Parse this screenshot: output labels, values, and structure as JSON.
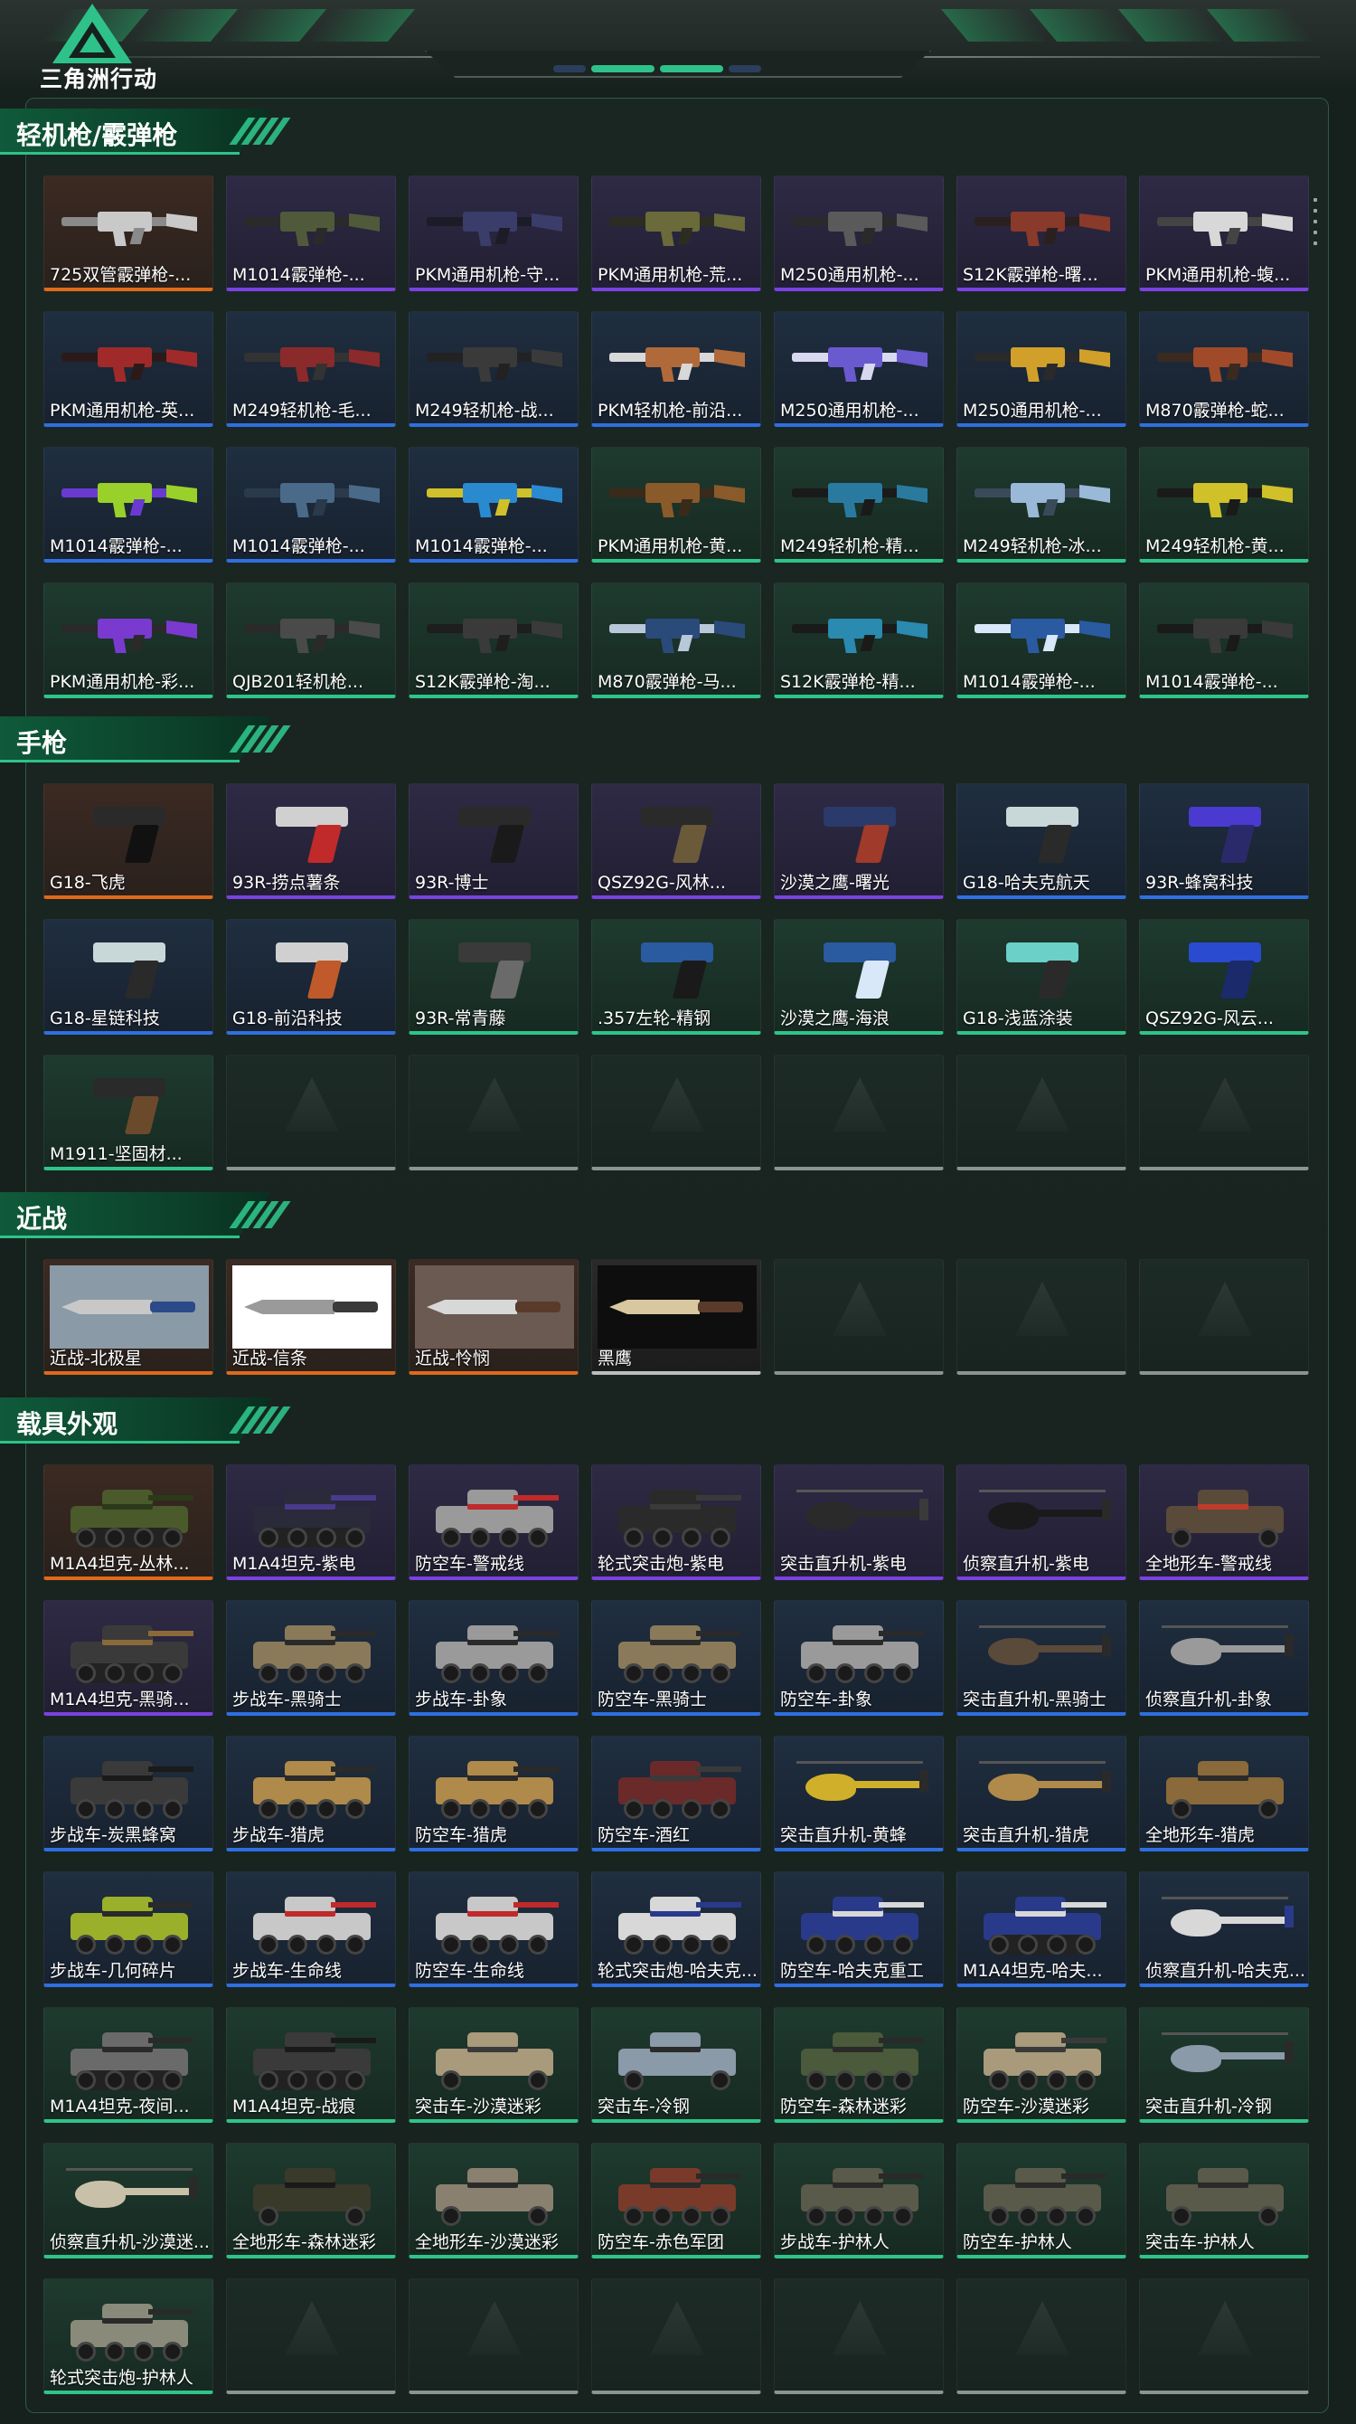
{
  "app": {
    "title": "三角洲行动"
  },
  "colors": {
    "accent": "#2ec28a",
    "rarity_orange": "#e06a1a",
    "rarity_purple": "#7a42e0",
    "rarity_blue": "#2f6fe0",
    "rarity_green": "#2fc48a",
    "rarity_white": "#bdbdbd",
    "empty_slot": "#8c948f"
  },
  "sections": [
    {
      "title": "轻机枪/霰弹枪",
      "kind": "gun",
      "items": [
        {
          "label": "725双管霰弹枪-...",
          "rarity": "orange",
          "tone": "#c9c9c9",
          "accent": "#8a8a8a"
        },
        {
          "label": "M1014霰弹枪-...",
          "rarity": "purple",
          "tone": "#505a3a",
          "accent": "#2a2a2a"
        },
        {
          "label": "PKM通用机枪-守...",
          "rarity": "purple",
          "tone": "#3a3d6a",
          "accent": "#1c1c28"
        },
        {
          "label": "PKM通用机枪-荒...",
          "rarity": "purple",
          "tone": "#6a6a3a",
          "accent": "#2c2c20"
        },
        {
          "label": "M250通用机枪-...",
          "rarity": "purple",
          "tone": "#5a5a5a",
          "accent": "#2a2a2a"
        },
        {
          "label": "S12K霰弹枪-曙...",
          "rarity": "purple",
          "tone": "#8a3a2a",
          "accent": "#2a2020"
        },
        {
          "label": "PKM通用机枪-蝮...",
          "rarity": "purple",
          "tone": "#d8d8d8",
          "accent": "#444444"
        },
        {
          "label": "PKM通用机枪-英...",
          "rarity": "blue",
          "tone": "#a02a2a",
          "accent": "#2a1a1a"
        },
        {
          "label": "M249轻机枪-毛...",
          "rarity": "blue",
          "tone": "#8a2a2a",
          "accent": "#333333"
        },
        {
          "label": "M249轻机枪-战...",
          "rarity": "blue",
          "tone": "#3a3a3a",
          "accent": "#222222"
        },
        {
          "label": "PKM轻机枪-前沿...",
          "rarity": "blue",
          "tone": "#b06a3a",
          "accent": "#d8d8d8"
        },
        {
          "label": "M250通用机枪-...",
          "rarity": "blue",
          "tone": "#6a5ad0",
          "accent": "#d8d8f0"
        },
        {
          "label": "M250通用机枪-...",
          "rarity": "blue",
          "tone": "#d0a02a",
          "accent": "#2a2a2a"
        },
        {
          "label": "M870霰弹枪-蛇...",
          "rarity": "blue",
          "tone": "#a04a2a",
          "accent": "#3a2a20"
        },
        {
          "label": "M1014霰弹枪-...",
          "rarity": "blue",
          "tone": "#9ad02a",
          "accent": "#6a3ad0"
        },
        {
          "label": "M1014霰弹枪-...",
          "rarity": "blue",
          "tone": "#4a6a8a",
          "accent": "#2a3a4a"
        },
        {
          "label": "M1014霰弹枪-...",
          "rarity": "blue",
          "tone": "#2a8ad0",
          "accent": "#d0c02a"
        },
        {
          "label": "PKM通用机枪-黄...",
          "rarity": "green",
          "tone": "#8a5a2a",
          "accent": "#3a2a1a"
        },
        {
          "label": "M249轻机枪-精...",
          "rarity": "green",
          "tone": "#2a7aa0",
          "accent": "#1a1a1a"
        },
        {
          "label": "M249轻机枪-冰...",
          "rarity": "green",
          "tone": "#9ab8d8",
          "accent": "#3a4a5a"
        },
        {
          "label": "M249轻机枪-黄...",
          "rarity": "green",
          "tone": "#d0c02a",
          "accent": "#1a1a1a"
        },
        {
          "label": "PKM通用机枪-彩...",
          "rarity": "green",
          "tone": "#7a3ad0",
          "accent": "#2a2a2a"
        },
        {
          "label": "QJB201轻机枪...",
          "rarity": "green",
          "tone": "#4a4a4a",
          "accent": "#2a2a2a"
        },
        {
          "label": "S12K霰弹枪-淘...",
          "rarity": "green",
          "tone": "#3a3a3a",
          "accent": "#1e1e1e"
        },
        {
          "label": "M870霰弹枪-马...",
          "rarity": "green",
          "tone": "#2a4a7a",
          "accent": "#b8c8d8"
        },
        {
          "label": "S12K霰弹枪-精...",
          "rarity": "green",
          "tone": "#2a8ab0",
          "accent": "#1a1a1a"
        },
        {
          "label": "M1014霰弹枪-...",
          "rarity": "green",
          "tone": "#2a5aa0",
          "accent": "#d8e8f8"
        },
        {
          "label": "M1014霰弹枪-...",
          "rarity": "green",
          "tone": "#3a3a3a",
          "accent": "#1a1a1a"
        }
      ],
      "empty_slots": 0
    },
    {
      "title": "手枪",
      "kind": "pistol",
      "items": [
        {
          "label": "G18-飞虎",
          "rarity": "orange",
          "tone": "#2a2a2a",
          "accent": "#111111"
        },
        {
          "label": "93R-捞点薯条",
          "rarity": "purple",
          "tone": "#d0d0d0",
          "accent": "#c02a2a"
        },
        {
          "label": "93R-博士",
          "rarity": "purple",
          "tone": "#2a2a2a",
          "accent": "#1a1a1a"
        },
        {
          "label": "QSZ92G-风林...",
          "rarity": "purple",
          "tone": "#2a2a2a",
          "accent": "#6a5a3a"
        },
        {
          "label": "沙漠之鹰-曙光",
          "rarity": "purple",
          "tone": "#2a3a6a",
          "accent": "#a03a2a"
        },
        {
          "label": "G18-哈夫克航天",
          "rarity": "blue",
          "tone": "#c8d8d8",
          "accent": "#2a2a2a"
        },
        {
          "label": "93R-蜂窝科技",
          "rarity": "blue",
          "tone": "#4a3ad0",
          "accent": "#2a2a6a"
        },
        {
          "label": "G18-星链科技",
          "rarity": "blue",
          "tone": "#c8d8d8",
          "accent": "#2a2a2a"
        },
        {
          "label": "G18-前沿科技",
          "rarity": "blue",
          "tone": "#d0d0d0",
          "accent": "#c05a2a"
        },
        {
          "label": "93R-常青藤",
          "rarity": "green",
          "tone": "#3a3a3a",
          "accent": "#6a6a6a"
        },
        {
          "label": ".357左轮-精钢",
          "rarity": "green",
          "tone": "#2a5aa0",
          "accent": "#1a1a1a"
        },
        {
          "label": "沙漠之鹰-海浪",
          "rarity": "green",
          "tone": "#2a5aa0",
          "accent": "#d8e8f8"
        },
        {
          "label": "G18-浅蓝涂装",
          "rarity": "green",
          "tone": "#6ad0c8",
          "accent": "#2a2a2a"
        },
        {
          "label": "QSZ92G-风云...",
          "rarity": "green",
          "tone": "#2a4ad0",
          "accent": "#1a2a6a"
        },
        {
          "label": "M1911-坚固材...",
          "rarity": "green",
          "tone": "#2a2a2a",
          "accent": "#6a4a2a"
        }
      ],
      "empty_slots": 6
    },
    {
      "title": "近战",
      "kind": "knife",
      "items": [
        {
          "label": "近战-北极星",
          "rarity": "orange",
          "tone": "#c8c8c8",
          "accent": "#2a4a8a",
          "photo": "#8a9aa6"
        },
        {
          "label": "近战-信条",
          "rarity": "orange",
          "tone": "#9a9a9a",
          "accent": "#3a3a3a",
          "photo": "#ffffff"
        },
        {
          "label": "近战-怜悯",
          "rarity": "orange",
          "tone": "#d8d8d8",
          "accent": "#5a3a2a",
          "photo": "#6a5a52"
        },
        {
          "label": "黑鹰",
          "rarity": "white",
          "tone": "#d8c8a0",
          "accent": "#5a3a2a",
          "photo": "#0e0e0e"
        }
      ],
      "empty_slots": 3
    },
    {
      "title": "载具外观",
      "kind": "vehicle",
      "items": [
        {
          "label": "M1A4坦克-丛林...",
          "rarity": "orange",
          "tone": "#4a5a2a",
          "accent": "#2a3a1a",
          "type": "tank"
        },
        {
          "label": "M1A4坦克-紫电",
          "rarity": "purple",
          "tone": "#2a2a3a",
          "accent": "#4a3a8a",
          "type": "tank"
        },
        {
          "label": "防空车-警戒线",
          "rarity": "purple",
          "tone": "#9a9a9a",
          "accent": "#c02a2a",
          "type": "apc"
        },
        {
          "label": "轮式突击炮-紫电",
          "rarity": "purple",
          "tone": "#2a2a2a",
          "accent": "#3a3a3a",
          "type": "apc"
        },
        {
          "label": "突击直升机-紫电",
          "rarity": "purple",
          "tone": "#2a2a2a",
          "accent": "#3a3a3a",
          "type": "heli"
        },
        {
          "label": "侦察直升机-紫电",
          "rarity": "purple",
          "tone": "#1a1a1a",
          "accent": "#2a2a2a",
          "type": "heli"
        },
        {
          "label": "全地形车-警戒线",
          "rarity": "purple",
          "tone": "#5a4a3a",
          "accent": "#c03a2a",
          "type": "atv"
        },
        {
          "label": "M1A4坦克-黑骑...",
          "rarity": "purple",
          "tone": "#3a3a3a",
          "accent": "#8a6a3a",
          "type": "tank"
        },
        {
          "label": "步战车-黑骑士",
          "rarity": "blue",
          "tone": "#8a7a5a",
          "accent": "#2a2a2a",
          "type": "apc"
        },
        {
          "label": "步战车-卦象",
          "rarity": "blue",
          "tone": "#9a9a9a",
          "accent": "#2a2a2a",
          "type": "apc"
        },
        {
          "label": "防空车-黑骑士",
          "rarity": "blue",
          "tone": "#8a7a5a",
          "accent": "#2a2a2a",
          "type": "apc"
        },
        {
          "label": "防空车-卦象",
          "rarity": "blue",
          "tone": "#9a9a9a",
          "accent": "#2a2a2a",
          "type": "apc"
        },
        {
          "label": "突击直升机-黑骑士",
          "rarity": "blue",
          "tone": "#5a4a3a",
          "accent": "#2a2a2a",
          "type": "heli"
        },
        {
          "label": "侦察直升机-卦象",
          "rarity": "blue",
          "tone": "#9a9a9a",
          "accent": "#2a2a2a",
          "type": "heli"
        },
        {
          "label": "步战车-炭黑蜂窝",
          "rarity": "blue",
          "tone": "#3a3a3a",
          "accent": "#1a1a1a",
          "type": "apc"
        },
        {
          "label": "步战车-猎虎",
          "rarity": "blue",
          "tone": "#b08a4a",
          "accent": "#2a2a2a",
          "type": "apc"
        },
        {
          "label": "防空车-猎虎",
          "rarity": "blue",
          "tone": "#b08a4a",
          "accent": "#2a2a2a",
          "type": "apc"
        },
        {
          "label": "防空车-酒红",
          "rarity": "blue",
          "tone": "#6a2a2a",
          "accent": "#3a3a3a",
          "type": "apc"
        },
        {
          "label": "突击直升机-黄蜂",
          "rarity": "blue",
          "tone": "#d0b02a",
          "accent": "#2a2a2a",
          "type": "heli"
        },
        {
          "label": "突击直升机-猎虎",
          "rarity": "blue",
          "tone": "#b08a4a",
          "accent": "#2a2a2a",
          "type": "heli"
        },
        {
          "label": "全地形车-猎虎",
          "rarity": "blue",
          "tone": "#8a6a3a",
          "accent": "#2a2a2a",
          "type": "atv"
        },
        {
          "label": "步战车-几何碎片",
          "rarity": "blue",
          "tone": "#9ab02a",
          "accent": "#2a2a2a",
          "type": "apc"
        },
        {
          "label": "步战车-生命线",
          "rarity": "blue",
          "tone": "#c8c8c8",
          "accent": "#c02a2a",
          "type": "apc"
        },
        {
          "label": "防空车-生命线",
          "rarity": "blue",
          "tone": "#c8c8c8",
          "accent": "#c02a2a",
          "type": "apc"
        },
        {
          "label": "轮式突击炮-哈夫克...",
          "rarity": "blue",
          "tone": "#d8d8d8",
          "accent": "#2a3a8a",
          "type": "apc"
        },
        {
          "label": "防空车-哈夫克重工",
          "rarity": "blue",
          "tone": "#2a3a8a",
          "accent": "#d8d8d8",
          "type": "apc"
        },
        {
          "label": "M1A4坦克-哈夫...",
          "rarity": "blue",
          "tone": "#2a3a8a",
          "accent": "#d8d8d8",
          "type": "tank"
        },
        {
          "label": "侦察直升机-哈夫克...",
          "rarity": "blue",
          "tone": "#d8d8d8",
          "accent": "#2a3a8a",
          "type": "heli"
        },
        {
          "label": "M1A4坦克-夜间...",
          "rarity": "green",
          "tone": "#6a6a6a",
          "accent": "#2a2a2a",
          "type": "tank"
        },
        {
          "label": "M1A4坦克-战痕",
          "rarity": "green",
          "tone": "#3a3a3a",
          "accent": "#1a1a1a",
          "type": "tank"
        },
        {
          "label": "突击车-沙漠迷彩",
          "rarity": "green",
          "tone": "#a89a7a",
          "accent": "#3a3a3a",
          "type": "truck"
        },
        {
          "label": "突击车-冷钢",
          "rarity": "green",
          "tone": "#8a9aa8",
          "accent": "#2a2a2a",
          "type": "truck"
        },
        {
          "label": "防空车-森林迷彩",
          "rarity": "green",
          "tone": "#4a5a3a",
          "accent": "#2a2a2a",
          "type": "apc"
        },
        {
          "label": "防空车-沙漠迷彩",
          "rarity": "green",
          "tone": "#a89a7a",
          "accent": "#3a3a3a",
          "type": "apc"
        },
        {
          "label": "突击直升机-冷钢",
          "rarity": "green",
          "tone": "#8a9aa8",
          "accent": "#2a2a2a",
          "type": "heli"
        },
        {
          "label": "侦察直升机-沙漠迷...",
          "rarity": "green",
          "tone": "#c8c0a8",
          "accent": "#2a2a2a",
          "type": "heli"
        },
        {
          "label": "全地形车-森林迷彩",
          "rarity": "green",
          "tone": "#3a3a2a",
          "accent": "#1a1a1a",
          "type": "atv"
        },
        {
          "label": "全地形车-沙漠迷彩",
          "rarity": "green",
          "tone": "#8a8070",
          "accent": "#2a2a2a",
          "type": "atv"
        },
        {
          "label": "防空车-赤色军团",
          "rarity": "green",
          "tone": "#7a3a2a",
          "accent": "#2a2a2a",
          "type": "apc"
        },
        {
          "label": "步战车-护林人",
          "rarity": "green",
          "tone": "#5a5a4a",
          "accent": "#2a2a2a",
          "type": "apc"
        },
        {
          "label": "防空车-护林人",
          "rarity": "green",
          "tone": "#5a5a4a",
          "accent": "#2a2a2a",
          "type": "apc"
        },
        {
          "label": "突击车-护林人",
          "rarity": "green",
          "tone": "#5a5a4a",
          "accent": "#2a2a2a",
          "type": "truck"
        },
        {
          "label": "轮式突击炮-护林人",
          "rarity": "green",
          "tone": "#8a8a7a",
          "accent": "#2a2a2a",
          "type": "apc"
        }
      ],
      "empty_slots": 6
    }
  ]
}
